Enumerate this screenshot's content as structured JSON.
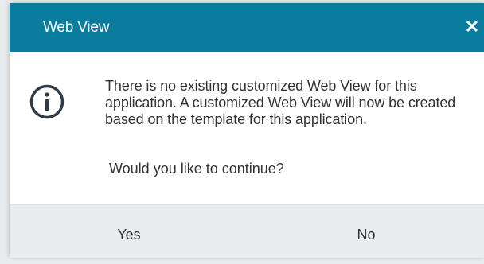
{
  "dialog": {
    "title": "Web View",
    "close_symbol": "✕",
    "icon": "info-icon",
    "message": "There is no existing customized Web View for this application. A customized Web View will now be created based on the template for this application.",
    "question": "Would you like to continue?",
    "buttons": {
      "yes": "Yes",
      "no": "No"
    }
  },
  "colors": {
    "titlebar": "#0a7d9e",
    "footer": "#e9edef",
    "text": "#333333"
  }
}
